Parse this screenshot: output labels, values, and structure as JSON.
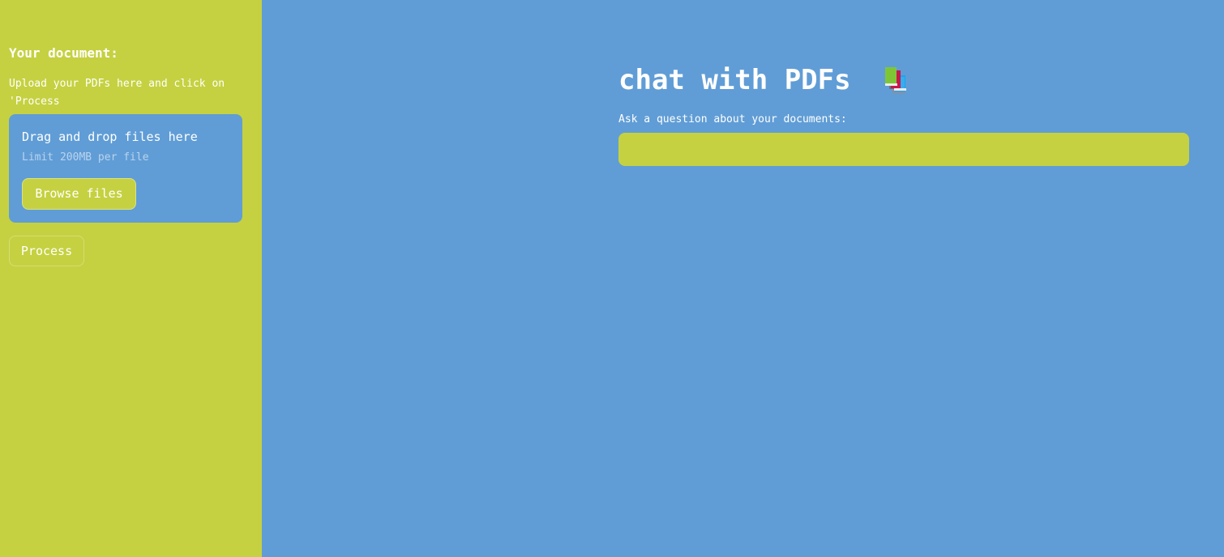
{
  "sidebar": {
    "title": "Your document:",
    "instructions": "Upload your PDFs here and click on 'Process",
    "uploader": {
      "title": "Drag and drop files here",
      "limit": "Limit 200MB per file",
      "browse_label": "Browse files"
    },
    "process_label": "Process"
  },
  "main": {
    "title": "chat with PDFs",
    "title_icon": "books-icon",
    "question_label": "Ask a question about your documents:",
    "question_value": ""
  },
  "colors": {
    "sidebar_bg": "#c5d141",
    "main_bg": "#609dd6",
    "text": "#ffffff"
  }
}
